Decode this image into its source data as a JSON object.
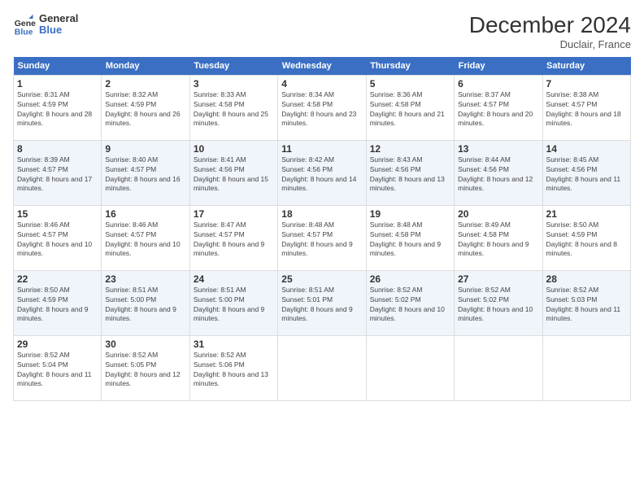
{
  "logo": {
    "line1": "General",
    "line2": "Blue"
  },
  "title": "December 2024",
  "location": "Duclair, France",
  "days_of_week": [
    "Sunday",
    "Monday",
    "Tuesday",
    "Wednesday",
    "Thursday",
    "Friday",
    "Saturday"
  ],
  "weeks": [
    [
      {
        "day": "1",
        "sunrise": "8:31 AM",
        "sunset": "4:59 PM",
        "daylight": "8 hours and 28 minutes."
      },
      {
        "day": "2",
        "sunrise": "8:32 AM",
        "sunset": "4:59 PM",
        "daylight": "8 hours and 26 minutes."
      },
      {
        "day": "3",
        "sunrise": "8:33 AM",
        "sunset": "4:58 PM",
        "daylight": "8 hours and 25 minutes."
      },
      {
        "day": "4",
        "sunrise": "8:34 AM",
        "sunset": "4:58 PM",
        "daylight": "8 hours and 23 minutes."
      },
      {
        "day": "5",
        "sunrise": "8:36 AM",
        "sunset": "4:58 PM",
        "daylight": "8 hours and 21 minutes."
      },
      {
        "day": "6",
        "sunrise": "8:37 AM",
        "sunset": "4:57 PM",
        "daylight": "8 hours and 20 minutes."
      },
      {
        "day": "7",
        "sunrise": "8:38 AM",
        "sunset": "4:57 PM",
        "daylight": "8 hours and 18 minutes."
      }
    ],
    [
      {
        "day": "8",
        "sunrise": "8:39 AM",
        "sunset": "4:57 PM",
        "daylight": "8 hours and 17 minutes."
      },
      {
        "day": "9",
        "sunrise": "8:40 AM",
        "sunset": "4:57 PM",
        "daylight": "8 hours and 16 minutes."
      },
      {
        "day": "10",
        "sunrise": "8:41 AM",
        "sunset": "4:56 PM",
        "daylight": "8 hours and 15 minutes."
      },
      {
        "day": "11",
        "sunrise": "8:42 AM",
        "sunset": "4:56 PM",
        "daylight": "8 hours and 14 minutes."
      },
      {
        "day": "12",
        "sunrise": "8:43 AM",
        "sunset": "4:56 PM",
        "daylight": "8 hours and 13 minutes."
      },
      {
        "day": "13",
        "sunrise": "8:44 AM",
        "sunset": "4:56 PM",
        "daylight": "8 hours and 12 minutes."
      },
      {
        "day": "14",
        "sunrise": "8:45 AM",
        "sunset": "4:56 PM",
        "daylight": "8 hours and 11 minutes."
      }
    ],
    [
      {
        "day": "15",
        "sunrise": "8:46 AM",
        "sunset": "4:57 PM",
        "daylight": "8 hours and 10 minutes."
      },
      {
        "day": "16",
        "sunrise": "8:46 AM",
        "sunset": "4:57 PM",
        "daylight": "8 hours and 10 minutes."
      },
      {
        "day": "17",
        "sunrise": "8:47 AM",
        "sunset": "4:57 PM",
        "daylight": "8 hours and 9 minutes."
      },
      {
        "day": "18",
        "sunrise": "8:48 AM",
        "sunset": "4:57 PM",
        "daylight": "8 hours and 9 minutes."
      },
      {
        "day": "19",
        "sunrise": "8:48 AM",
        "sunset": "4:58 PM",
        "daylight": "8 hours and 9 minutes."
      },
      {
        "day": "20",
        "sunrise": "8:49 AM",
        "sunset": "4:58 PM",
        "daylight": "8 hours and 9 minutes."
      },
      {
        "day": "21",
        "sunrise": "8:50 AM",
        "sunset": "4:59 PM",
        "daylight": "8 hours and 8 minutes."
      }
    ],
    [
      {
        "day": "22",
        "sunrise": "8:50 AM",
        "sunset": "4:59 PM",
        "daylight": "8 hours and 9 minutes."
      },
      {
        "day": "23",
        "sunrise": "8:51 AM",
        "sunset": "5:00 PM",
        "daylight": "8 hours and 9 minutes."
      },
      {
        "day": "24",
        "sunrise": "8:51 AM",
        "sunset": "5:00 PM",
        "daylight": "8 hours and 9 minutes."
      },
      {
        "day": "25",
        "sunrise": "8:51 AM",
        "sunset": "5:01 PM",
        "daylight": "8 hours and 9 minutes."
      },
      {
        "day": "26",
        "sunrise": "8:52 AM",
        "sunset": "5:02 PM",
        "daylight": "8 hours and 10 minutes."
      },
      {
        "day": "27",
        "sunrise": "8:52 AM",
        "sunset": "5:02 PM",
        "daylight": "8 hours and 10 minutes."
      },
      {
        "day": "28",
        "sunrise": "8:52 AM",
        "sunset": "5:03 PM",
        "daylight": "8 hours and 11 minutes."
      }
    ],
    [
      {
        "day": "29",
        "sunrise": "8:52 AM",
        "sunset": "5:04 PM",
        "daylight": "8 hours and 11 minutes."
      },
      {
        "day": "30",
        "sunrise": "8:52 AM",
        "sunset": "5:05 PM",
        "daylight": "8 hours and 12 minutes."
      },
      {
        "day": "31",
        "sunrise": "8:52 AM",
        "sunset": "5:06 PM",
        "daylight": "8 hours and 13 minutes."
      },
      null,
      null,
      null,
      null
    ]
  ],
  "labels": {
    "sunrise": "Sunrise:",
    "sunset": "Sunset:",
    "daylight": "Daylight:"
  }
}
